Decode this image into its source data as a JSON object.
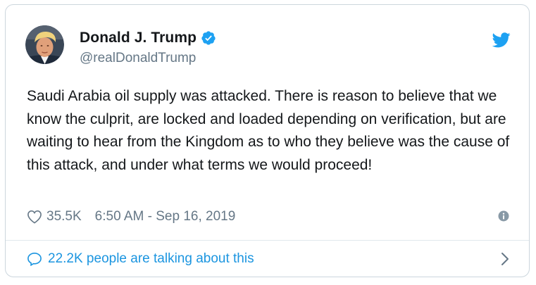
{
  "author": {
    "name": "Donald J. Trump",
    "handle": "@realDonaldTrump",
    "verified": true
  },
  "tweet": {
    "text": "Saudi Arabia oil supply was attacked. There is reason to believe that we know the culprit, are locked and loaded depending on verification, but are waiting to hear from the Kingdom as to who they believe was the cause of this attack, and under what terms we would proceed!"
  },
  "meta": {
    "likes": "35.5K",
    "timestamp": "6:50 AM - Sep 16, 2019"
  },
  "footer": {
    "talking": "22.2K people are talking about this"
  },
  "icons": {
    "brand": "twitter-bird-icon",
    "verified": "verified-badge-icon",
    "like": "heart-icon",
    "info": "info-icon",
    "reply": "speech-bubble-icon",
    "chevron": "chevron-right-icon"
  },
  "colors": {
    "brand_blue": "#1da1f2",
    "link_blue": "#1b95e0",
    "text": "#14171a",
    "secondary": "#657786",
    "border": "#ccd6dd"
  }
}
